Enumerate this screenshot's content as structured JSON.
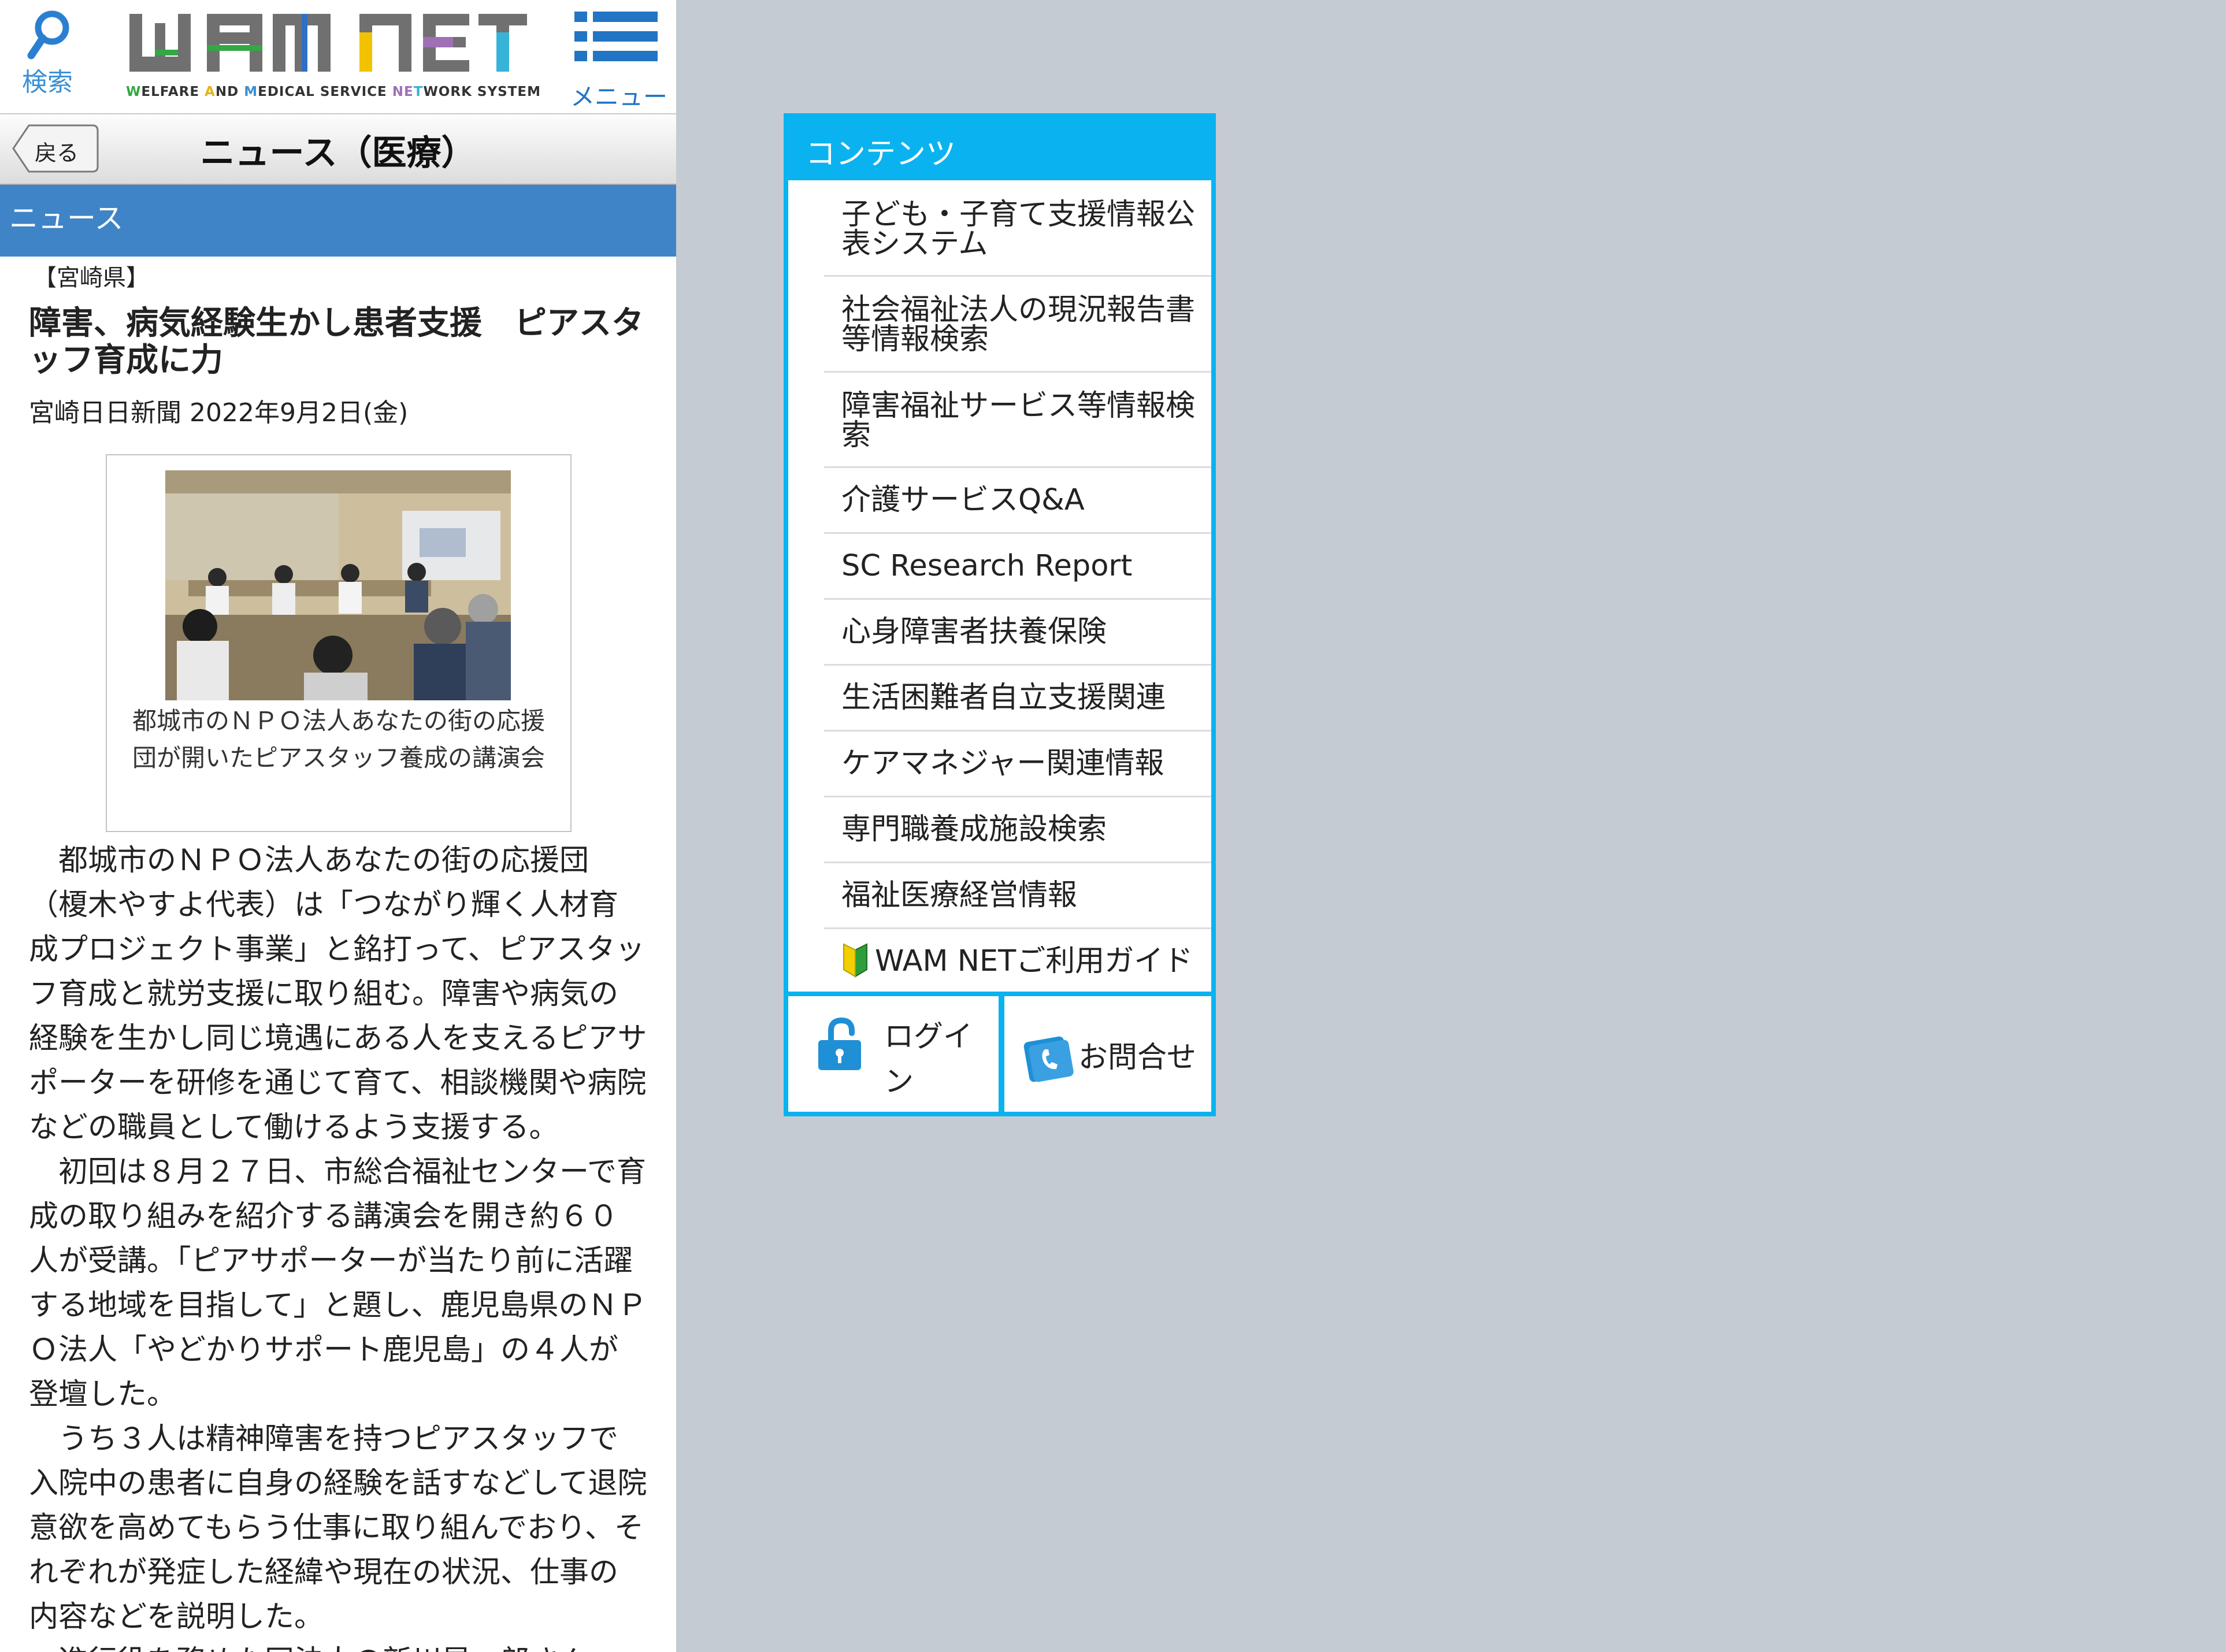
{
  "header": {
    "search_label": "検索",
    "logo_tagline_parts": [
      "W",
      "ELFARE ",
      "A",
      "ND ",
      "M",
      "EDICAL SERVICE ",
      "NE",
      "T",
      "WORK SYSTEM"
    ],
    "menu_label": "メニュー"
  },
  "titlebar": {
    "back_label": "戻る",
    "title": "ニュース（医療）"
  },
  "section": {
    "label": "ニュース"
  },
  "article": {
    "prefecture": "【宮崎県】",
    "headline": "障害、病気経験生かし患者支援　ピアスタッフ育成に力",
    "source": "宮崎日日新聞 2022年9月2日(金)",
    "photo_caption": "都城市のＮＰＯ法人あなたの街の応援団が開いたピアスタッフ養成の講演会",
    "paragraphs": [
      "都城市のＮＰＯ法人あなたの街の応援団（榎木やすよ代表）は「つながり輝く人材育成プロジェクト事業」と銘打って、ピアスタッフ育成と就労支援に取り組む。障害や病気の経験を生かし同じ境遇にある人を支えるピアサポーターを研修を通じて育て、相談機関や病院などの職員として働けるよう支援する。",
      "初回は８月２７日、市総合福祉センターで育成の取り組みを紹介する講演会を開き約６０人が受講。「ピアサポーターが当たり前に活躍する地域を目指して」と題し、鹿児島県のＮＰＯ法人「やどかりサポート鹿児島」の４人が登壇した。",
      "うち３人は精神障害を持つピアスタッフで入院中の患者に自身の経験を話すなどして退院意欲を高めてもらう仕事に取り組んでおり、それぞれが発症した経緯や現在の状況、仕事の内容などを説明した。",
      "進行役を務めた同法人の新川昇一郎さん（精"
    ]
  },
  "contents_panel": {
    "title": "コンテンツ",
    "items": [
      "子ども・子育て支援情報公表システム",
      "社会福祉法人の現況報告書等情報検索",
      "障害福祉サービス等情報検索",
      "介護サービスQ&A",
      "SC Research Report",
      "心身障害者扶養保険",
      "生活困難者自立支援関連",
      "ケアマネジャー関連情報",
      "専門職養成施設検索",
      "福祉医療経営情報",
      "WAM NETご利用ガイド"
    ],
    "login_label": "ログイン",
    "contact_label": "お問合せ"
  },
  "colors": {
    "section_bar": "#3f84c6",
    "panel_accent": "#0ab3f0",
    "background": "#c5cbd3"
  }
}
